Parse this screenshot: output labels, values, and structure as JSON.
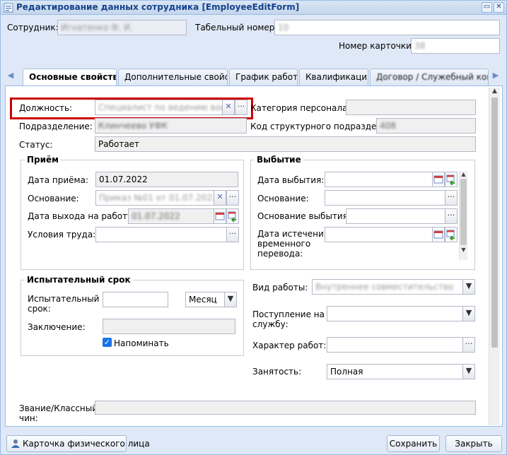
{
  "window": {
    "title": "Редактирование данных сотрудника [EmployeeEditForm]"
  },
  "header": {
    "employee_label": "Сотрудник:",
    "employee_value": "Игнатенко Ф. И.",
    "tab_number_label": "Табельный номер:",
    "tab_number_value": "10",
    "card_number_label": "Номер карточки:",
    "card_number_value": "38"
  },
  "tabs": [
    {
      "label": "Основные свойства"
    },
    {
      "label": "Дополнительные свойства"
    },
    {
      "label": "График работы"
    },
    {
      "label": "Квалификация"
    },
    {
      "label": "Договор / Служебный контракт"
    }
  ],
  "main": {
    "position_label": "Должность:",
    "position_value": "Специалист по ведению воинского учета",
    "category_label": "Категория персонала:",
    "category_value": "",
    "department_label": "Подразделение:",
    "department_value": "Клинчеево УФК",
    "struct_code_label": "Код структурного подразделения:",
    "struct_code_value": "408",
    "status_label": "Статус:",
    "status_value": "Работает"
  },
  "hire": {
    "legend": "Приём",
    "date_label": "Дата приёма:",
    "date_value": "01.07.2022",
    "basis_label": "Основание:",
    "basis_value": "Приказ №01 от 01.07.2022",
    "work_start_label": "Дата выхода на работу:",
    "work_start_value": "01.07.2022",
    "conditions_label": "Условия труда:",
    "conditions_value": ""
  },
  "leave": {
    "legend": "Выбытие",
    "date_label": "Дата выбытия:",
    "basis_label": "Основание:",
    "reason_label": "Основание выбытия:",
    "transfer_end_label_1": "Дата истечения",
    "transfer_end_label_2": "временного",
    "transfer_end_label_3": "перевода:"
  },
  "probation": {
    "legend": "Испытательный срок",
    "term_label_1": "Испытательный",
    "term_label_2": "срок:",
    "term_value": "",
    "unit_value": "Месяц",
    "conclusion_label": "Заключение:",
    "remind_label": "Напоминать"
  },
  "work": {
    "type_label": "Вид работы:",
    "type_value": "Внутреннее совместительство",
    "entry_label_1": "Поступление на",
    "entry_label_2": "службу:",
    "nature_label": "Характер работ:",
    "employment_label": "Занятость:",
    "employment_value": "Полная"
  },
  "rank": {
    "label_1": "Звание/Классный",
    "label_2": "чин:"
  },
  "footer": {
    "person_card_button": "Карточка физического лица",
    "save_button": "Сохранить",
    "close_button": "Закрыть"
  },
  "colors": {
    "highlight": "#cc0000",
    "title": "#15428b",
    "border": "#99bbe8"
  }
}
